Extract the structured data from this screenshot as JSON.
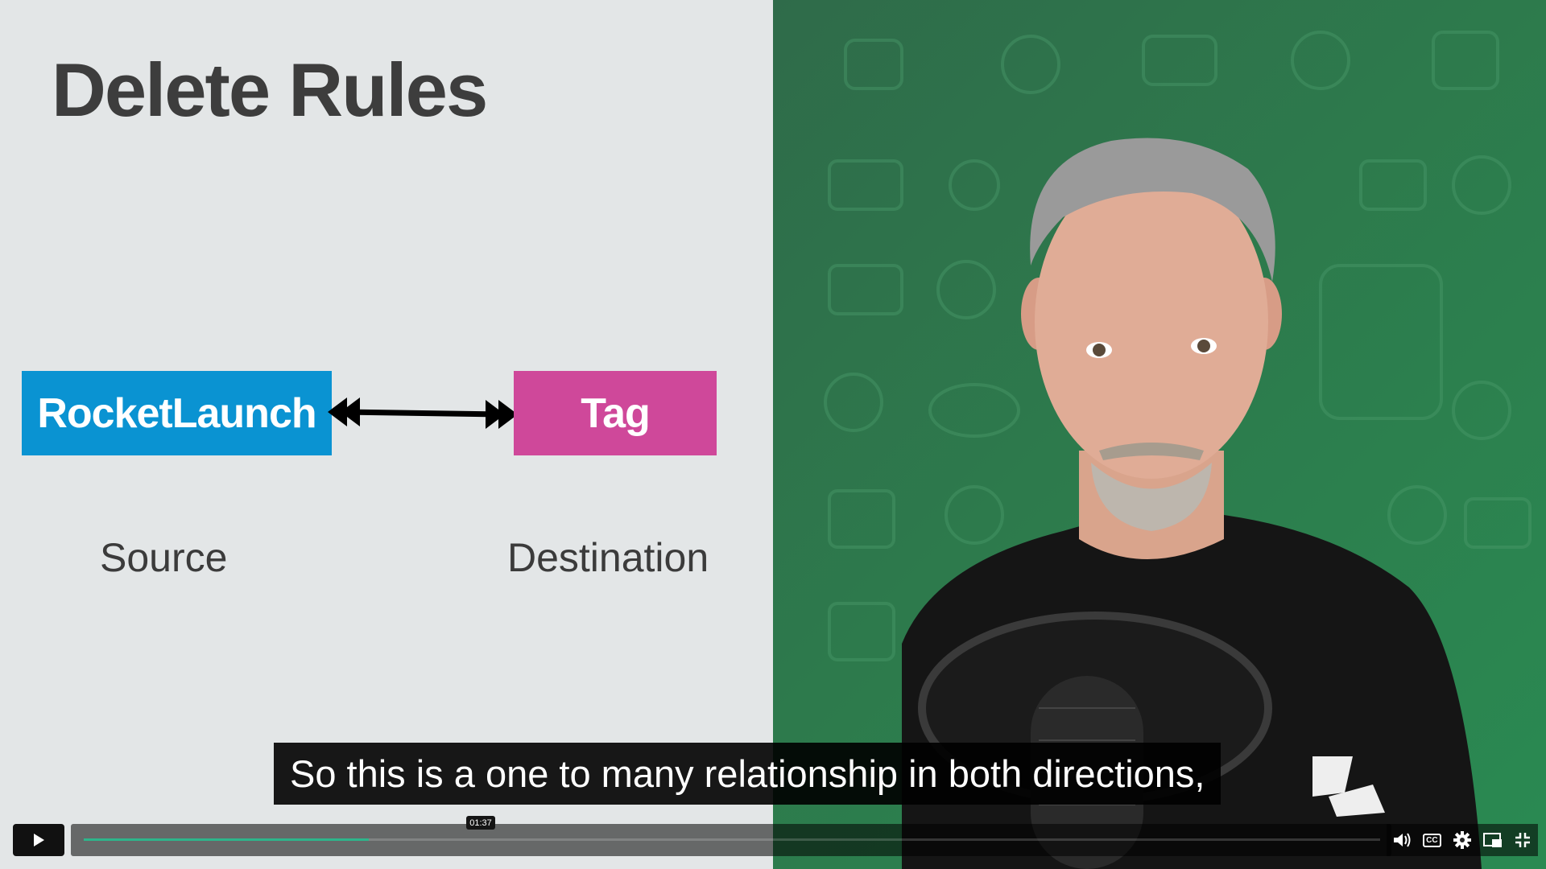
{
  "slide": {
    "title": "Delete Rules",
    "source_entity": "RocketLaunch",
    "destination_entity": "Tag",
    "source_label": "Source",
    "destination_label": "Destination",
    "colors": {
      "background": "#e3e6e7",
      "source": "#0a93d2",
      "destination": "#cf489a"
    }
  },
  "caption": {
    "text": "So this is a one to many relationship in both directions,"
  },
  "player": {
    "current_time": "01:37",
    "progress": 0.22,
    "accent_color": "#2eb58b",
    "cc_label": "CC",
    "icons": [
      "play-icon",
      "volume-icon",
      "closed-captions-icon",
      "settings-gear-icon",
      "picture-in-picture-icon",
      "exit-fullscreen-icon"
    ]
  }
}
